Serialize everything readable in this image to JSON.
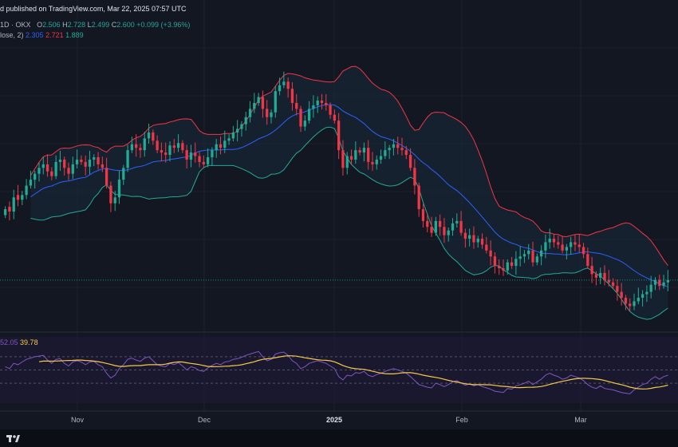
{
  "header": {
    "published": "d published on TradingView.com, Mar 22, 2025 07:57 UTC",
    "symbol": "1D · OKX",
    "ohlc": {
      "o_label": "O",
      "o": "2.506",
      "h_label": "H",
      "h": "2.728",
      "l_label": "L",
      "l": "2.499",
      "c_label": "C",
      "c": "2.600",
      "change": "+0.099 (+3.96%)"
    },
    "bb_label": "lose, 2)",
    "bb_values": {
      "basis": "2.305",
      "upper": "2.721",
      "lower": "1.889"
    }
  },
  "rsi": {
    "value": "52.05",
    "ma": "39.78"
  },
  "x_axis": {
    "months": [
      {
        "label": "Nov",
        "bold": false
      },
      {
        "label": "Dec",
        "bold": false
      },
      {
        "label": "2025",
        "bold": true
      },
      {
        "label": "Feb",
        "bold": false
      },
      {
        "label": "Mar",
        "bold": false
      }
    ]
  },
  "colors": {
    "background": "#131722",
    "up": "#22ab94",
    "down": "#f23645",
    "basis": "#2962ff",
    "upper": "#f23645",
    "lower": "#22ab94",
    "band_fill": "#1a2a3a",
    "rsi": "#7e57c2",
    "rsi_ma": "#f7c948",
    "rsi_bg": "#1e1a33"
  },
  "chart_data": {
    "type": "candlestick",
    "close": [
      2.2,
      2.18,
      2.3,
      2.28,
      2.32,
      2.4,
      2.45,
      2.5,
      2.55,
      2.58,
      2.52,
      2.48,
      2.6,
      2.62,
      2.55,
      2.5,
      2.58,
      2.62,
      2.6,
      2.56,
      2.62,
      2.64,
      2.58,
      2.55,
      2.4,
      2.25,
      2.3,
      2.45,
      2.55,
      2.7,
      2.75,
      2.72,
      2.7,
      2.8,
      2.85,
      2.78,
      2.7,
      2.68,
      2.66,
      2.74,
      2.72,
      2.76,
      2.7,
      2.62,
      2.68,
      2.65,
      2.6,
      2.58,
      2.64,
      2.7,
      2.75,
      2.72,
      2.78,
      2.8,
      2.85,
      2.88,
      2.92,
      2.98,
      3.05,
      3.1,
      3.15,
      3.05,
      2.98,
      3.02,
      3.2,
      3.25,
      3.28,
      3.22,
      3.1,
      3.05,
      2.9,
      2.95,
      3.05,
      3.08,
      3.12,
      3.1,
      3.08,
      3.0,
      2.95,
      2.7,
      2.55,
      2.65,
      2.62,
      2.7,
      2.68,
      2.72,
      2.6,
      2.58,
      2.62,
      2.65,
      2.7,
      2.72,
      2.75,
      2.72,
      2.7,
      2.66,
      2.55,
      2.4,
      2.2,
      2.1,
      2.05,
      2.0,
      2.1,
      2.05,
      1.98,
      2.02,
      2.08,
      2.1,
      2.0,
      1.95,
      1.98,
      1.92,
      1.95,
      1.9,
      1.85,
      1.8,
      1.72,
      1.7,
      1.68,
      1.75,
      1.72,
      1.78,
      1.8,
      1.82,
      1.85,
      1.75,
      1.8,
      1.85,
      1.92,
      1.95,
      1.92,
      1.9,
      1.85,
      1.88,
      1.92,
      1.9,
      1.88,
      1.82,
      1.72,
      1.65,
      1.62,
      1.66,
      1.6,
      1.58,
      1.55,
      1.5,
      1.45,
      1.4,
      1.38,
      1.42,
      1.45,
      1.48,
      1.5,
      1.56,
      1.6,
      1.55,
      1.58,
      1.6
    ],
    "open": [
      2.15,
      2.22,
      2.18,
      2.32,
      2.28,
      2.32,
      2.4,
      2.45,
      2.5,
      2.55,
      2.58,
      2.52,
      2.48,
      2.6,
      2.62,
      2.55,
      2.5,
      2.58,
      2.62,
      2.6,
      2.56,
      2.62,
      2.64,
      2.58,
      2.55,
      2.4,
      2.25,
      2.3,
      2.45,
      2.55,
      2.7,
      2.75,
      2.72,
      2.7,
      2.8,
      2.85,
      2.78,
      2.7,
      2.68,
      2.66,
      2.74,
      2.72,
      2.76,
      2.7,
      2.62,
      2.68,
      2.65,
      2.6,
      2.58,
      2.64,
      2.7,
      2.75,
      2.72,
      2.78,
      2.8,
      2.85,
      2.88,
      2.92,
      2.98,
      3.05,
      3.1,
      3.15,
      3.05,
      2.98,
      3.02,
      3.2,
      3.25,
      3.28,
      3.22,
      3.1,
      3.05,
      2.9,
      2.95,
      3.05,
      3.08,
      3.12,
      3.1,
      3.08,
      3.0,
      2.95,
      2.7,
      2.55,
      2.65,
      2.62,
      2.7,
      2.68,
      2.72,
      2.6,
      2.58,
      2.62,
      2.65,
      2.7,
      2.72,
      2.75,
      2.72,
      2.7,
      2.66,
      2.55,
      2.4,
      2.2,
      2.1,
      2.05,
      2.0,
      2.1,
      2.05,
      1.98,
      2.02,
      2.08,
      2.1,
      2.0,
      1.95,
      1.98,
      1.92,
      1.95,
      1.9,
      1.85,
      1.8,
      1.72,
      1.7,
      1.68,
      1.75,
      1.72,
      1.78,
      1.8,
      1.82,
      1.85,
      1.75,
      1.8,
      1.85,
      1.92,
      1.95,
      1.92,
      1.9,
      1.85,
      1.88,
      1.92,
      1.9,
      1.88,
      1.82,
      1.72,
      1.65,
      1.62,
      1.66,
      1.6,
      1.58,
      1.55,
      1.5,
      1.45,
      1.4,
      1.38,
      1.42,
      1.45,
      1.48,
      1.5,
      1.56,
      1.6,
      1.55,
      1.58
    ],
    "price_range": [
      1.2,
      3.6
    ],
    "rsi_values": [
      55,
      52,
      60,
      58,
      62,
      66,
      68,
      70,
      71,
      72,
      65,
      60,
      66,
      67,
      60,
      56,
      62,
      64,
      62,
      58,
      62,
      63,
      58,
      55,
      45,
      38,
      42,
      52,
      58,
      66,
      68,
      65,
      63,
      68,
      70,
      64,
      58,
      56,
      55,
      60,
      58,
      61,
      56,
      50,
      55,
      53,
      49,
      48,
      53,
      57,
      60,
      58,
      62,
      63,
      66,
      67,
      69,
      72,
      74,
      76,
      78,
      70,
      64,
      66,
      74,
      76,
      77,
      72,
      64,
      60,
      52,
      55,
      60,
      62,
      64,
      62,
      60,
      56,
      52,
      40,
      35,
      42,
      41,
      46,
      45,
      48,
      42,
      40,
      43,
      45,
      48,
      50,
      52,
      50,
      48,
      45,
      40,
      34,
      28,
      26,
      24,
      23,
      30,
      28,
      25,
      28,
      32,
      34,
      30,
      27,
      29,
      26,
      28,
      25,
      23,
      21,
      18,
      17,
      16,
      22,
      21,
      26,
      28,
      30,
      33,
      28,
      32,
      36,
      42,
      45,
      42,
      40,
      36,
      38,
      42,
      40,
      38,
      34,
      28,
      24,
      22,
      26,
      22,
      21,
      20,
      18,
      16,
      15,
      14,
      20,
      24,
      28,
      30,
      36,
      40,
      36,
      40,
      42
    ],
    "x_ticks": [
      "Nov",
      "Dec",
      "2025",
      "Feb",
      "Mar"
    ]
  }
}
